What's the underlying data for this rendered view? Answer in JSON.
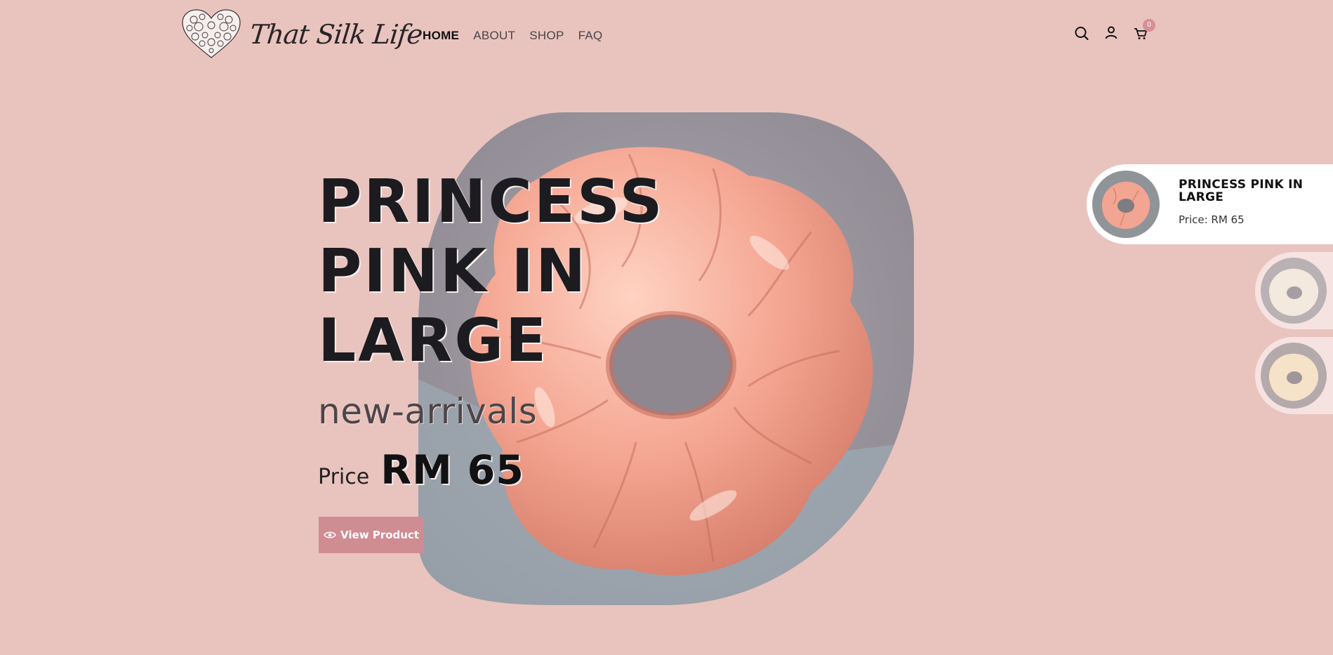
{
  "brand": {
    "name": "That Silk Life",
    "logo_icon": "heart-flowers-icon"
  },
  "nav": {
    "items": [
      {
        "label": "HOME",
        "active": true
      },
      {
        "label": "ABOUT",
        "active": false
      },
      {
        "label": "SHOP",
        "active": false
      },
      {
        "label": "FAQ",
        "active": false
      }
    ]
  },
  "header_icons": {
    "search": "search-icon",
    "account": "user-icon",
    "cart": "cart-icon",
    "cart_count": "0"
  },
  "hero": {
    "title_lines": [
      "PRINCESS",
      "PINK IN",
      "LARGE"
    ],
    "category": "new-arrivals",
    "price_label": "Price",
    "price_value": "RM 65",
    "button_label": "View Product",
    "button_icon": "eye-icon"
  },
  "slides": [
    {
      "title": "PRINCESS PINK IN LARGE",
      "price": "Price: RM 65",
      "color": "#f2a592"
    },
    {
      "color": "#eee3d6"
    },
    {
      "color": "#f1dcc2"
    }
  ],
  "colors": {
    "background": "#e9c4bf",
    "accent": "#cf8c92",
    "badge": "#d49096"
  }
}
